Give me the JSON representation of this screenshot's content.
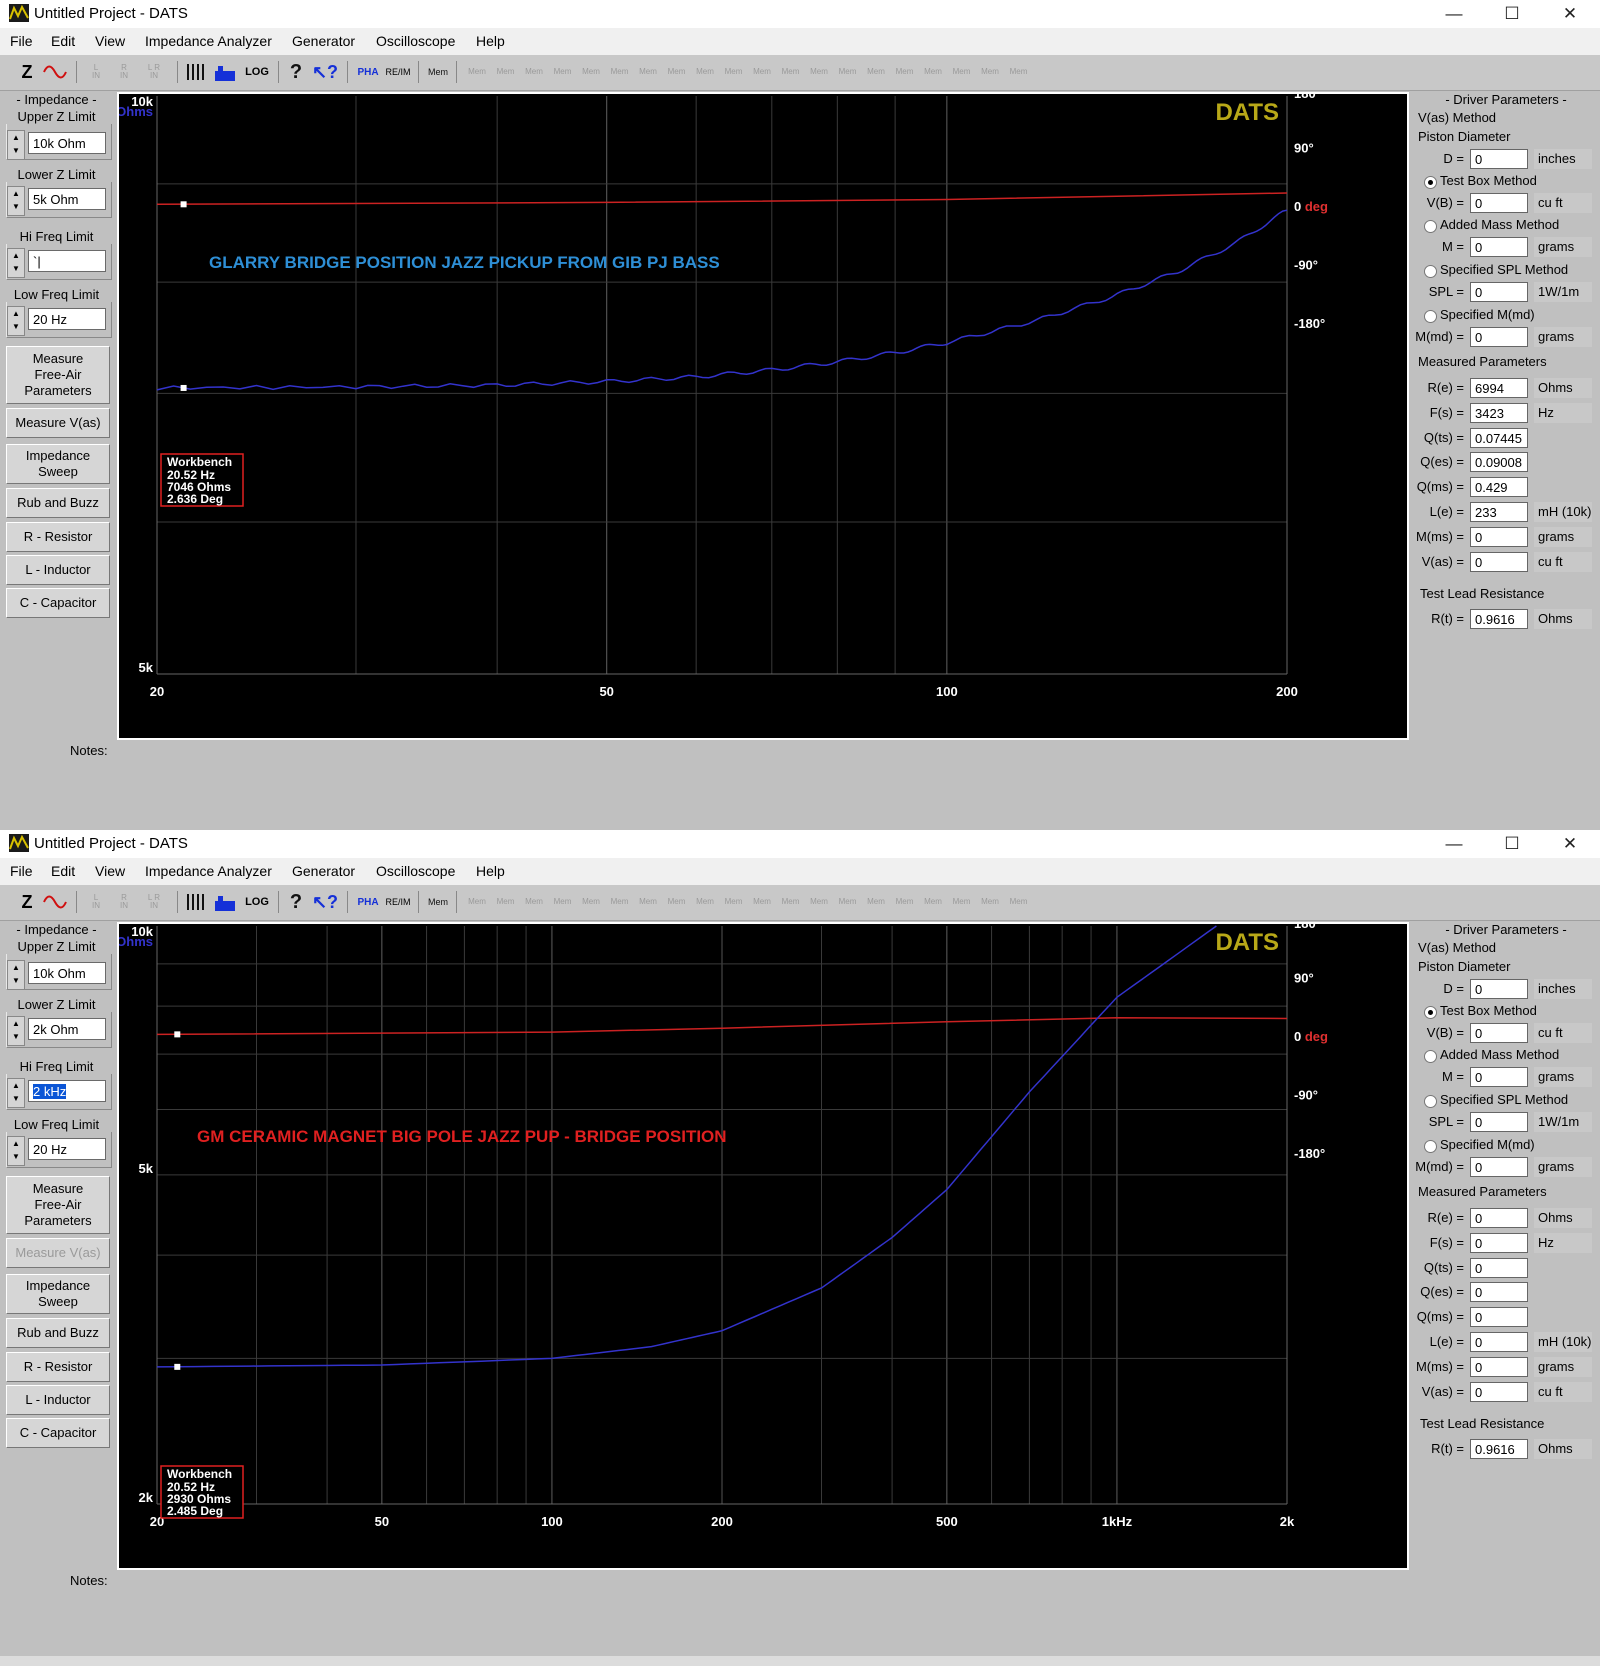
{
  "windows": [
    {
      "title": "Untitled Project - DATS",
      "menu": [
        "File",
        "Edit",
        "View",
        "Impedance Analyzer",
        "Generator",
        "Oscilloscope",
        "Help"
      ],
      "toolbar": {
        "z": "Z",
        "log": "LOG",
        "pha": "PHA",
        "reim": "RE/IM",
        "mem_w": "Mem",
        "mem_label": "Mem"
      },
      "left": {
        "impedance_header": "- Impedance -",
        "upper_label": "Upper Z Limit",
        "upper_value": "10k Ohm",
        "lower_label": "Lower Z Limit",
        "lower_value": "5k Ohm",
        "hifreq_label": "Hi Freq Limit",
        "hifreq_value": "`|",
        "lowfreq_label": "Low Freq Limit",
        "lowfreq_value": "20 Hz",
        "btn_free_air": "Measure Free-Air Parameters",
        "btn_vas": "Measure V(as)",
        "btn_sweep": "Impedance Sweep",
        "btn_rub": "Rub and Buzz",
        "btn_r": "R - Resistor",
        "btn_l": "L - Inductor",
        "btn_c": "C - Capacitor",
        "vas_disabled": false
      },
      "notes_label": "Notes:",
      "chart_data": {
        "type": "line",
        "title": "GLARRY BRIDGE POSITION JAZZ PICKUP FROM GIB PJ BASS",
        "title_color": "#2e8fd6",
        "brand": "DATS",
        "x_scale": "log",
        "xlim": [
          20,
          200
        ],
        "x_ticks": [
          "20",
          "50",
          "100",
          "200"
        ],
        "x_tick_values": [
          20,
          50,
          100,
          200
        ],
        "y_ticks": [
          "10k",
          "5k"
        ],
        "y_unit": "Ohms",
        "y_right_ticks": [
          "180°",
          "90°",
          "0 deg",
          "-90°",
          "-180°"
        ],
        "series": [
          {
            "name": "Ohms",
            "color": "#3333cc",
            "x": [
              20,
              30,
              40,
              50,
              60,
              70,
              80,
              90,
              100,
              120,
              140,
              160,
              180,
              200
            ],
            "y": [
              7046,
              7055,
              7070,
              7100,
              7140,
              7200,
              7270,
              7350,
              7440,
              7640,
              7860,
              8100,
              8380,
              8720
            ]
          },
          {
            "name": "deg",
            "color": "#cc2222",
            "x": [
              20,
              50,
              100,
              200
            ],
            "y": [
              2.6,
              5.5,
              10,
              20
            ]
          }
        ],
        "cursor_box": {
          "title": "Workbench",
          "lines": [
            "20.52 Hz",
            "7046 Ohms",
            "2.636 Deg"
          ]
        }
      },
      "right": {
        "header": "- Driver Parameters -",
        "vas_method": "V(as) Method",
        "piston": "Piston Diameter",
        "d_label": "D =",
        "d_value": "0",
        "d_unit": "inches",
        "test_box": "Test Box Method",
        "vb_label": "V(B) =",
        "vb_value": "0",
        "vb_unit": "cu ft",
        "added_mass": "Added Mass Method",
        "m_label": "M =",
        "m_value": "0",
        "m_unit": "grams",
        "spl_method": "Specified SPL Method",
        "spl_label": "SPL =",
        "spl_value": "0",
        "spl_unit": "1W/1m",
        "mmd_method": "Specified M(md)",
        "mmd_label": "M(md) =",
        "mmd_value": "0",
        "mmd_unit": "grams",
        "measured": "Measured Parameters",
        "params": [
          {
            "label": "R(e) =",
            "value": "6994",
            "unit": "Ohms"
          },
          {
            "label": "F(s) =",
            "value": "3423",
            "unit": "Hz"
          },
          {
            "label": "Q(ts) =",
            "value": "0.07445",
            "unit": ""
          },
          {
            "label": "Q(es) =",
            "value": "0.09008",
            "unit": ""
          },
          {
            "label": "Q(ms) =",
            "value": "0.429",
            "unit": ""
          },
          {
            "label": "L(e) =",
            "value": "233",
            "unit": "mH (10k)"
          },
          {
            "label": "M(ms) =",
            "value": "0",
            "unit": "grams"
          },
          {
            "label": "V(as) =",
            "value": "0",
            "unit": "cu ft"
          }
        ],
        "lead": "Test Lead Resistance",
        "rt_label": "R(t) =",
        "rt_value": "0.9616",
        "rt_unit": "Ohms"
      }
    },
    {
      "title": "Untitled Project - DATS",
      "menu": [
        "File",
        "Edit",
        "View",
        "Impedance Analyzer",
        "Generator",
        "Oscilloscope",
        "Help"
      ],
      "toolbar": {
        "z": "Z",
        "log": "LOG",
        "pha": "PHA",
        "reim": "RE/IM",
        "mem_w": "Mem",
        "mem_label": "Mem"
      },
      "left": {
        "impedance_header": "- Impedance -",
        "upper_label": "Upper Z Limit",
        "upper_value": "10k Ohm",
        "lower_label": "Lower Z Limit",
        "lower_value": "2k Ohm",
        "hifreq_label": "Hi Freq Limit",
        "hifreq_value": "2 kHz",
        "lowfreq_label": "Low Freq Limit",
        "lowfreq_value": "20 Hz",
        "btn_free_air": "Measure Free-Air Parameters",
        "btn_vas": "Measure V(as)",
        "btn_sweep": "Impedance Sweep",
        "btn_rub": "Rub and Buzz",
        "btn_r": "R - Resistor",
        "btn_l": "L - Inductor",
        "btn_c": "C - Capacitor",
        "vas_disabled": true
      },
      "notes_label": "Notes:",
      "chart_data": {
        "type": "line",
        "title": "GM  CERAMIC MAGNET BIG POLE JAZZ PUP - BRIDGE POSITION",
        "title_color": "#e02020",
        "brand": "DATS",
        "x_scale": "log",
        "xlim": [
          20,
          2000
        ],
        "x_ticks": [
          "20",
          "50",
          "100",
          "200",
          "500",
          "1kHz",
          "2k"
        ],
        "x_tick_values": [
          20,
          50,
          100,
          200,
          500,
          1000,
          2000
        ],
        "y_ticks": [
          "10k",
          "5k",
          "2k"
        ],
        "y_unit": "Ohms",
        "y_right_ticks": [
          "180°",
          "90°",
          "0 deg",
          "-90°",
          "-180°"
        ],
        "series": [
          {
            "name": "Ohms",
            "color": "#3333cc",
            "x": [
              20,
              50,
              100,
              150,
              200,
              300,
              400,
              500,
              700,
              1000,
              1500
            ],
            "y": [
              2930,
              2945,
              3000,
              3100,
              3240,
              3650,
              4200,
              4800,
              6300,
              8200,
              10000
            ]
          },
          {
            "name": "deg",
            "color": "#cc2222",
            "x": [
              20,
              100,
              200,
              500,
              1000,
              2000
            ],
            "y": [
              2.5,
              6,
              12,
              22,
              28,
              27
            ]
          }
        ],
        "cursor_box": {
          "title": "Workbench",
          "lines": [
            "20.52 Hz",
            "2930 Ohms",
            "2.485 Deg"
          ]
        }
      },
      "right": {
        "header": "- Driver Parameters -",
        "vas_method": "V(as) Method",
        "piston": "Piston Diameter",
        "d_label": "D =",
        "d_value": "0",
        "d_unit": "inches",
        "test_box": "Test Box Method",
        "vb_label": "V(B) =",
        "vb_value": "0",
        "vb_unit": "cu ft",
        "added_mass": "Added Mass Method",
        "m_label": "M =",
        "m_value": "0",
        "m_unit": "grams",
        "spl_method": "Specified SPL Method",
        "spl_label": "SPL =",
        "spl_value": "0",
        "spl_unit": "1W/1m",
        "mmd_method": "Specified M(md)",
        "mmd_label": "M(md) =",
        "mmd_value": "0",
        "mmd_unit": "grams",
        "measured": "Measured Parameters",
        "params": [
          {
            "label": "R(e) =",
            "value": "0",
            "unit": "Ohms"
          },
          {
            "label": "F(s) =",
            "value": "0",
            "unit": "Hz"
          },
          {
            "label": "Q(ts) =",
            "value": "0",
            "unit": ""
          },
          {
            "label": "Q(es) =",
            "value": "0",
            "unit": ""
          },
          {
            "label": "Q(ms) =",
            "value": "0",
            "unit": ""
          },
          {
            "label": "L(e) =",
            "value": "0",
            "unit": "mH (10k)"
          },
          {
            "label": "M(ms) =",
            "value": "0",
            "unit": "grams"
          },
          {
            "label": "V(as) =",
            "value": "0",
            "unit": "cu ft"
          }
        ],
        "lead": "Test Lead Resistance",
        "rt_label": "R(t) =",
        "rt_value": "0.9616",
        "rt_unit": "Ohms"
      }
    }
  ]
}
